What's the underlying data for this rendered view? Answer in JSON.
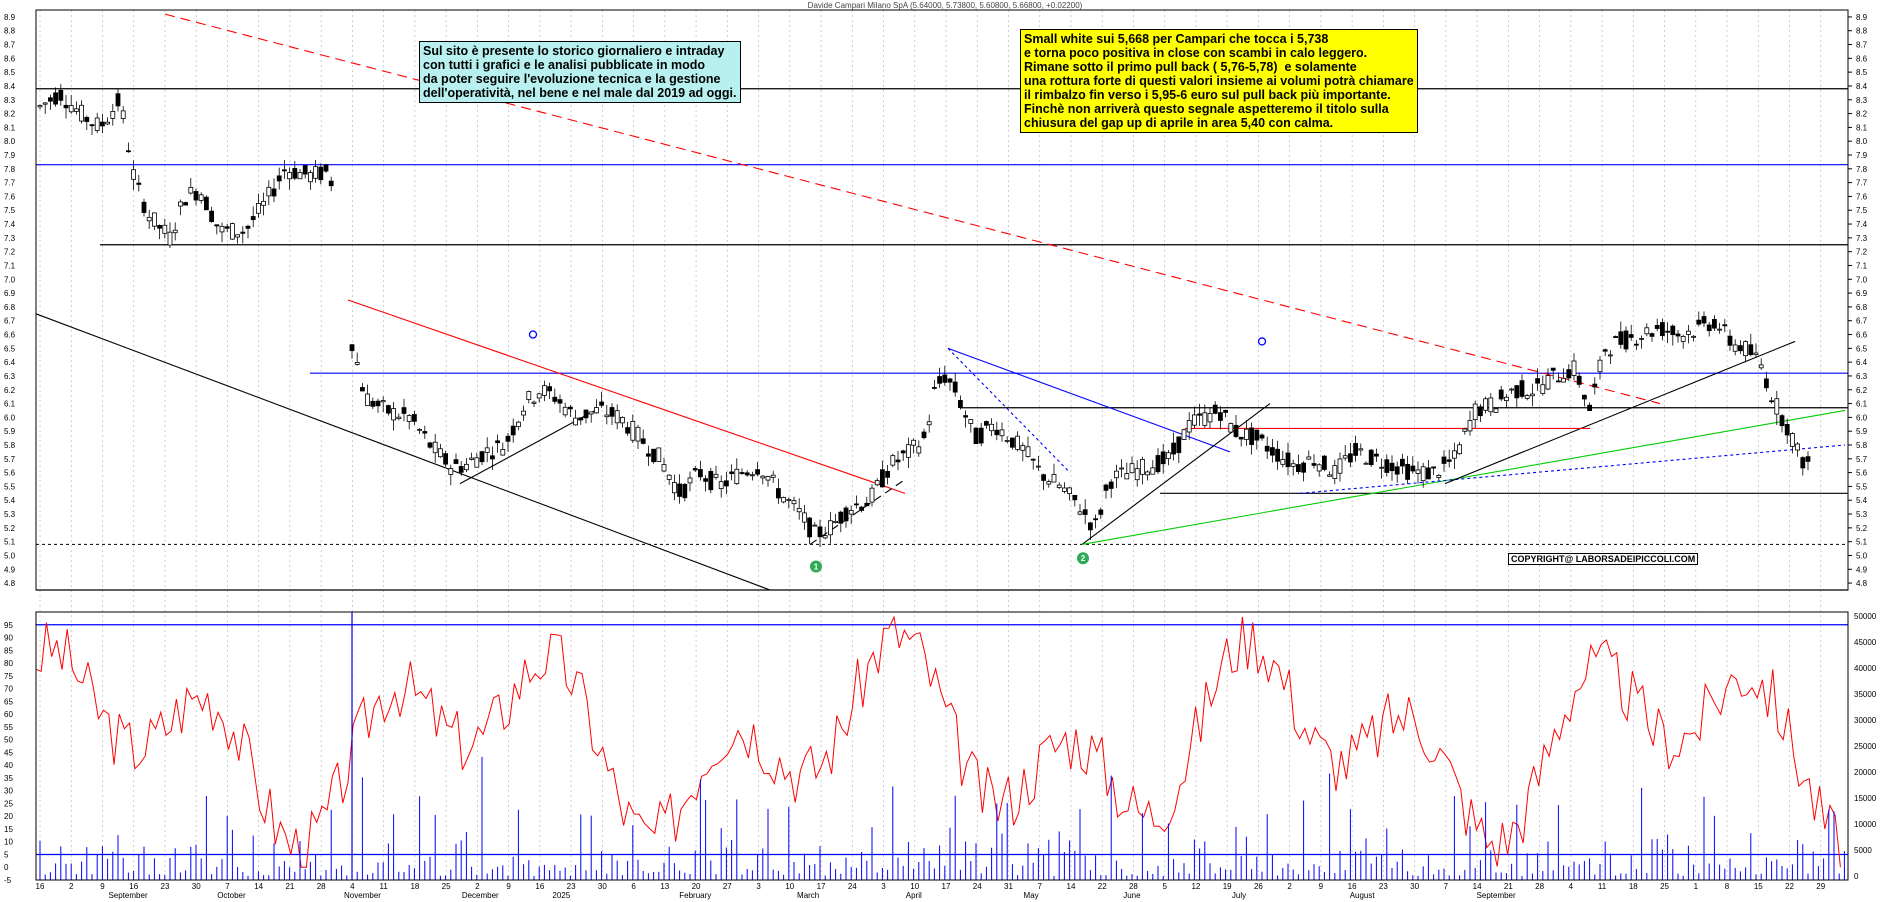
{
  "title": "Davide Campari Milano SpA (5.64000, 5.73800, 5.60800, 5.66800, +0.02200)",
  "note_left": "Sul sito è presente lo storico giornaliero e intraday\ncon tutti i grafici e le analisi pubblicate in modo\nda poter seguire l'evoluzione tecnica e la gestione\ndell'operatività, nel bene e nel male dal 2019 ad oggi.",
  "note_right": "Small white sui 5,668 per Campari che tocca i 5,738\ne torna poco positiva in close con scambi in calo leggero.\nRimane sotto il primo pull back ( 5,76-5,78)  e solamente\nuna rottura forte di questi valori insieme ai volumi potrà chiamare\nil rimbalzo fin verso i 5,95-6 euro sul pull back più importante.\nFinchè non arriverà questo segnale aspetteremo il titolo sulla\nchiusura del gap up di aprile in area 5,40 con calma.",
  "copyright": "COPYRIGHT@ LABORSADEIPICCOLI.COM",
  "markers": [
    "1",
    "2"
  ],
  "colors": {
    "support": "#000000",
    "resistance": "#0000ff",
    "trend_red": "#ff0000",
    "trend_green": "#00cc00",
    "oscillator": "#ff0000",
    "volume": "#0000ff",
    "note_cyan": "#b8f0f0",
    "note_yellow": "#ffff00"
  },
  "chart_data": [
    {
      "type": "candlestick",
      "yticks": [
        "8.9",
        "8.8",
        "8.7",
        "8.6",
        "8.5",
        "8.4",
        "8.3",
        "8.2",
        "8.1",
        "8.0",
        "7.9",
        "7.8",
        "7.7",
        "7.6",
        "7.5",
        "7.4",
        "7.3",
        "7.2",
        "7.1",
        "7.0",
        "6.9",
        "6.8",
        "6.7",
        "6.6",
        "6.5",
        "6.4",
        "6.3",
        "6.2",
        "6.1",
        "6.0",
        "5.9",
        "5.8",
        "5.7",
        "5.6",
        "5.5",
        "5.4",
        "5.3",
        "5.2",
        "5.1",
        "5.0",
        "4.9",
        "4.8"
      ],
      "ylim": [
        4.75,
        8.95
      ],
      "horizontal_levels": {
        "black": [
          8.38,
          7.25,
          6.07,
          5.45,
          4.75
        ],
        "blue": [
          7.83,
          6.32
        ],
        "dashed_black": [
          5.08
        ]
      },
      "last": {
        "open": 5.64,
        "high": 5.738,
        "low": 5.608,
        "close": 5.668,
        "change": 0.022
      }
    },
    {
      "type": "line",
      "yticks_left": [
        "95",
        "90",
        "85",
        "80",
        "75",
        "70",
        "65",
        "60",
        "55",
        "50",
        "45",
        "40",
        "35",
        "30",
        "25",
        "20",
        "15",
        "10",
        "5",
        "0",
        "-5"
      ],
      "yticks_right": [
        "50000",
        "45000",
        "40000",
        "35000",
        "30000",
        "25000",
        "20000",
        "15000",
        "10000",
        "5000",
        "0"
      ],
      "ylim": [
        -5,
        100
      ],
      "levels": [
        95,
        5
      ]
    }
  ],
  "x_days": [
    "16",
    "2",
    "9",
    "16",
    "23",
    "30",
    "7",
    "14",
    "21",
    "28",
    "4",
    "11",
    "18",
    "25",
    "2",
    "9",
    "16",
    "23",
    "30",
    "6",
    "13",
    "20",
    "27",
    "3",
    "10",
    "17",
    "24",
    "3",
    "10",
    "17",
    "24",
    "31",
    "7",
    "14",
    "22",
    "28",
    "5",
    "12",
    "19",
    "26",
    "2",
    "9",
    "16",
    "23",
    "30",
    "7",
    "14",
    "21",
    "28",
    "4",
    "11",
    "18",
    "25",
    "1",
    "8",
    "15",
    "22",
    "29"
  ],
  "x_months": [
    "September",
    "October",
    "November",
    "December",
    "2025",
    "February",
    "March",
    "April",
    "May",
    "June",
    "July",
    "August",
    "September"
  ]
}
